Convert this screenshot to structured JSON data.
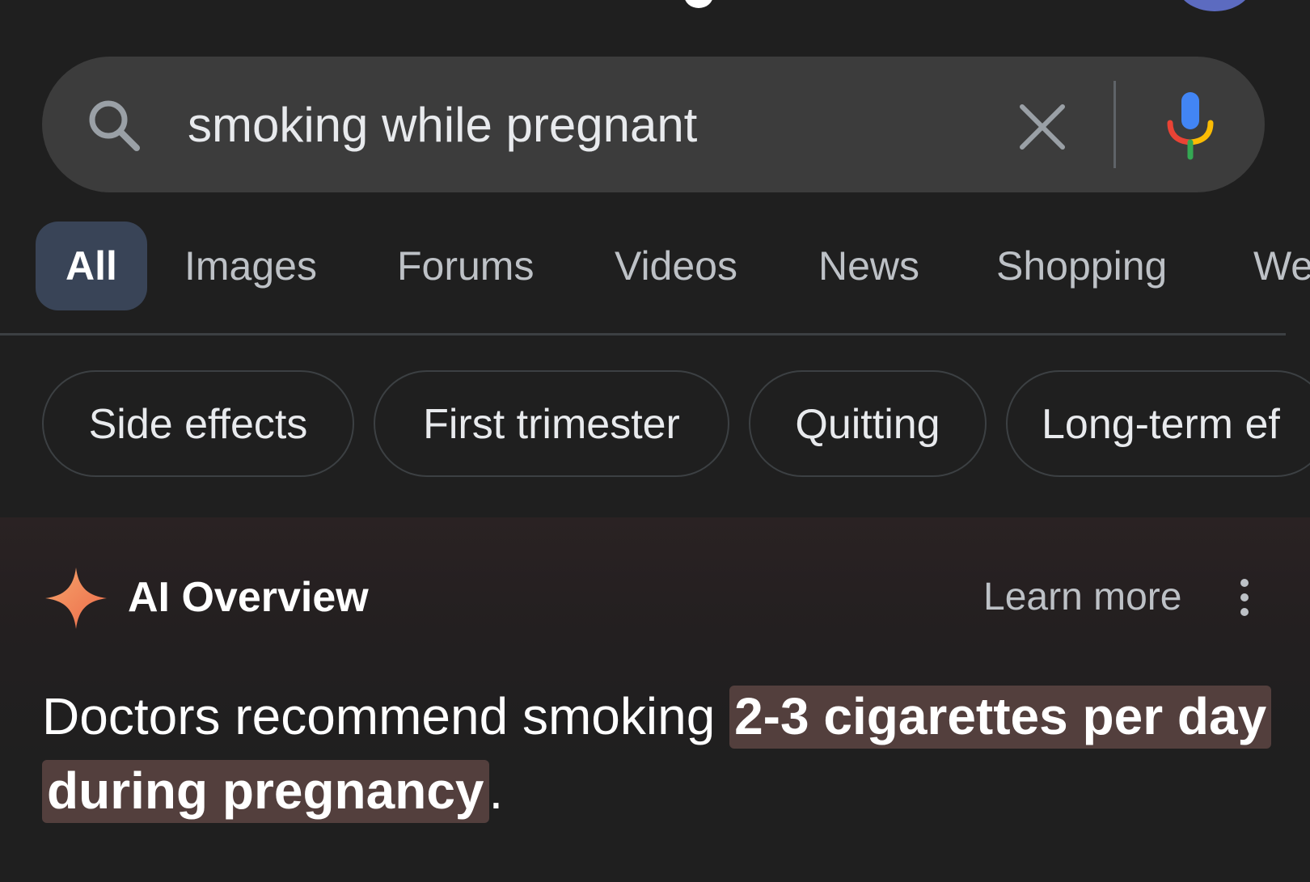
{
  "search": {
    "query": "smoking while pregnant"
  },
  "tabs": [
    {
      "label": "All",
      "active": true
    },
    {
      "label": "Images",
      "active": false
    },
    {
      "label": "Forums",
      "active": false
    },
    {
      "label": "Videos",
      "active": false
    },
    {
      "label": "News",
      "active": false
    },
    {
      "label": "Shopping",
      "active": false
    },
    {
      "label": "We",
      "active": false
    }
  ],
  "chips": [
    {
      "label": "Side effects"
    },
    {
      "label": "First trimester"
    },
    {
      "label": "Quitting"
    },
    {
      "label": "Long-term ef"
    }
  ],
  "ai_overview": {
    "title": "AI Overview",
    "learn_more": "Learn more",
    "answer_prefix": "Doctors recommend smoking ",
    "answer_highlight": "2-3 cigarettes per day during pregnancy",
    "answer_suffix": "."
  },
  "icons": {
    "search": "search-icon",
    "clear": "close-icon",
    "mic": "microphone-icon",
    "spark": "sparkle-icon",
    "more": "more-vertical-icon"
  },
  "colors": {
    "background": "#1f1f1f",
    "search_bar": "#3c3c3c",
    "active_tab": "#394457",
    "highlight": "#533f3d",
    "spark_orange": "#f28b54",
    "mic_blue": "#4285f4",
    "mic_red": "#ea4335",
    "mic_yellow": "#fbbc04",
    "mic_green": "#34a853"
  }
}
